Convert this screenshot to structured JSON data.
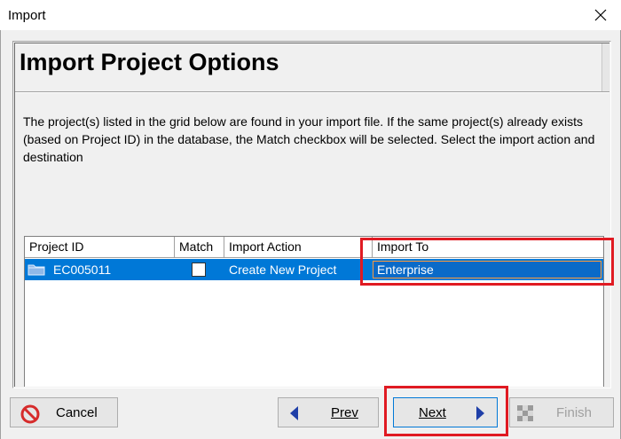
{
  "window": {
    "title": "Import",
    "close_glyph": "✕"
  },
  "header": {
    "title": "Import Project Options"
  },
  "description": "The project(s) listed in the grid below are found in your import file. If the same project(s) already exists (based on Project ID) in the database, the Match checkbox will be selected.  Select the import action and destination",
  "grid": {
    "columns": [
      "Project ID",
      "Match",
      "Import Action",
      "Import To"
    ],
    "rows": [
      {
        "project_id": "EC005011",
        "match": false,
        "import_action": "Create New Project",
        "import_to": "Enterprise",
        "icon": "folder-icon",
        "selected": true
      }
    ]
  },
  "buttons": {
    "cancel": "Cancel",
    "prev": "Prev",
    "next": "Next",
    "finish": "Finish"
  },
  "colors": {
    "selection": "#0078d7",
    "highlight_box": "#e01a22",
    "nav_arrow": "#1f3fa8",
    "cancel_icon": "#d62b2b"
  }
}
